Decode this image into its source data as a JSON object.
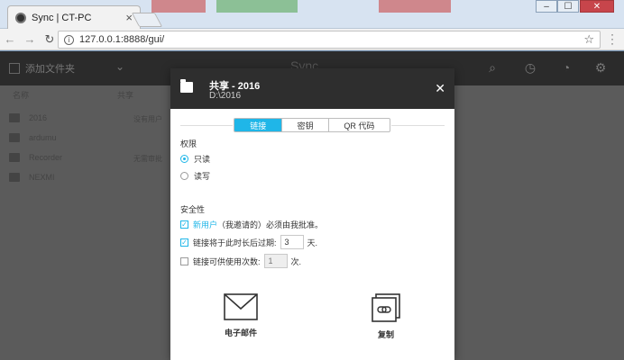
{
  "browser": {
    "tab_title": "Sync | CT-PC",
    "url": "127.0.0.1:8888/gui/"
  },
  "app": {
    "add_folder_label": "添加文件夹",
    "logo": "Sync",
    "col_name": "名称",
    "col_peers": "共享",
    "folders": [
      "2016",
      "ardumu",
      "Recorder",
      "NEXMI"
    ],
    "peers_text": [
      "没有用户",
      "无需审批"
    ]
  },
  "modal": {
    "title": "共享 - 2016",
    "path": "D:\\2016",
    "tabs": [
      "链接",
      "密钥",
      "QR 代码"
    ],
    "active_tab": "链接",
    "permissions": {
      "title": "权限",
      "options": [
        "只读",
        "读写"
      ],
      "selected": "只读"
    },
    "security": {
      "title": "安全性",
      "approve_highlight": "新用户",
      "approve_rest": "（我邀请的）必须由我批准。",
      "approve_checked": true,
      "expire_label": "链接将于此时长后过期:",
      "expire_value": "3",
      "expire_unit": "天.",
      "expire_checked": true,
      "uses_label": "链接可供使用次数:",
      "uses_value": "1",
      "uses_unit": "次.",
      "uses_checked": false
    },
    "actions": {
      "email_label": "电子邮件",
      "copy_label": "复制"
    }
  },
  "colors": {
    "accent": "#1fb6e8",
    "header": "#2e2e2e"
  }
}
